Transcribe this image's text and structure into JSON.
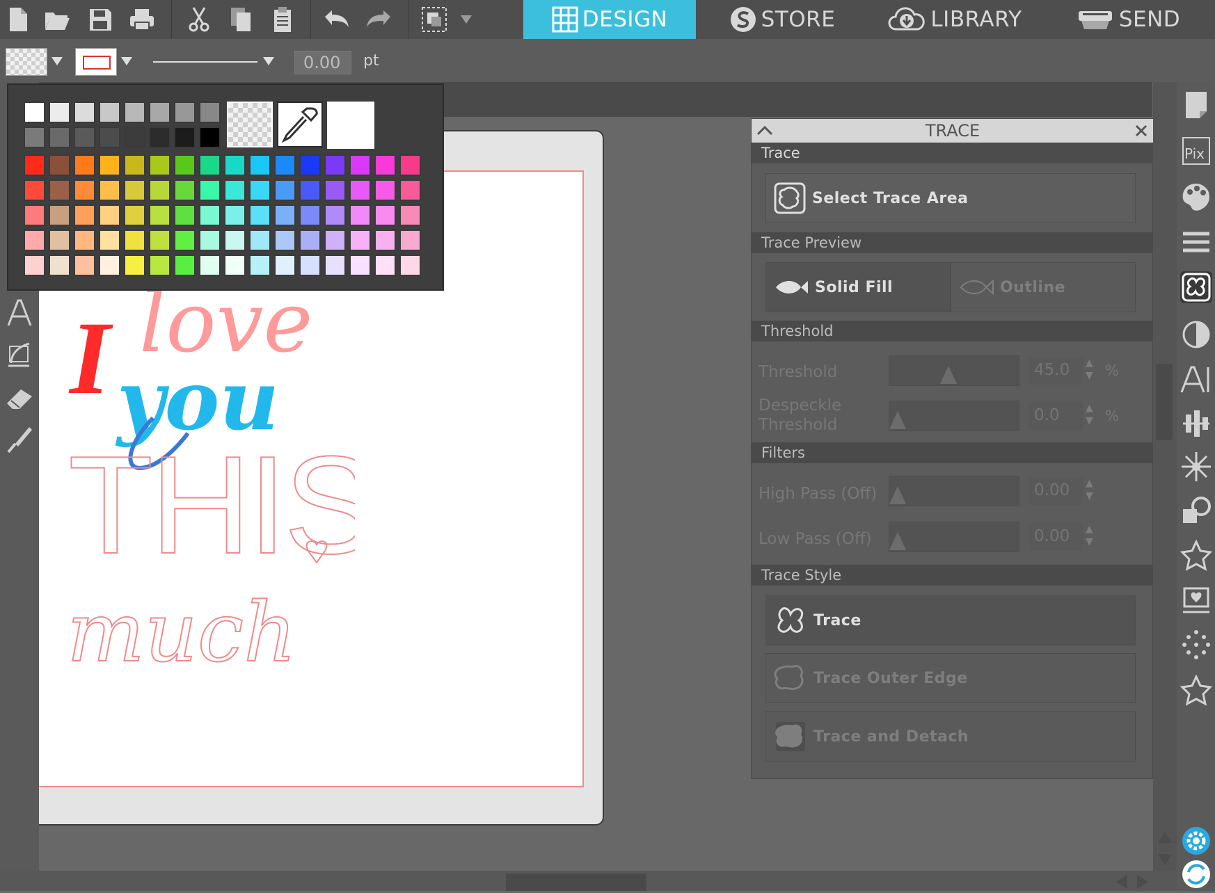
{
  "topbar": {
    "file_icons": [
      "new-document-icon",
      "open-folder-icon",
      "save-icon",
      "print-icon"
    ],
    "edit_icons": [
      "cut-icon",
      "copy-icon",
      "paste-icon"
    ],
    "history_icons": [
      "undo-icon",
      "redo-icon"
    ],
    "group_icon": "group-arrange-icon",
    "tabs": [
      {
        "label": "DESIGN",
        "icon": "grid-icon",
        "active": true
      },
      {
        "label": "STORE",
        "icon": "store-s-icon",
        "active": false
      },
      {
        "label": "LIBRARY",
        "icon": "cloud-download-icon",
        "active": false
      },
      {
        "label": "SEND",
        "icon": "cutter-icon",
        "active": false
      }
    ],
    "accent_color": "#3bbfdc"
  },
  "toolbar": {
    "line_width_value": "0.00",
    "line_width_unit": "pt"
  },
  "palette": {
    "grays_top": [
      "#ffffff",
      "#ececec",
      "#dcdcdc",
      "#c8c8c8",
      "#b8b8b8",
      "#a8a8a8",
      "#989898",
      "#888888"
    ],
    "grays_bottom": [
      "#7a7a7a",
      "#6a6a6a",
      "#5a5a5a",
      "#4c4c4c",
      "#3c3c3c",
      "#2c2c2c",
      "#1c1c1c",
      "#000000"
    ],
    "color_rows": [
      [
        "#ff2a1a",
        "#8a5038",
        "#ff7a1a",
        "#ffb21a",
        "#c8b81a",
        "#a8c81a",
        "#58c81a",
        "#1ad88a",
        "#1ad8c8",
        "#1ac8f8",
        "#1a8af8",
        "#1a3af8",
        "#7a3af8",
        "#d83af8",
        "#f83ad8",
        "#f83a8a"
      ],
      [
        "#ff4a3a",
        "#9a6048",
        "#ff8a3a",
        "#ffbe4a",
        "#d8c83a",
        "#b8d83a",
        "#68d83a",
        "#3af8aa",
        "#3ae8d8",
        "#3ad8f8",
        "#4a9af8",
        "#4a5af8",
        "#9a5af8",
        "#e85af8",
        "#f85ae8",
        "#f85a9a"
      ],
      [
        "#ff7a7a",
        "#c8a080",
        "#ffa05a",
        "#ffd080",
        "#e0d040",
        "#b8e040",
        "#60e040",
        "#7af8d0",
        "#7af0e8",
        "#5ae0f8",
        "#7ab0f8",
        "#7a8af8",
        "#b08af8",
        "#f08af8",
        "#f88af0",
        "#f88ab8"
      ],
      [
        "#ffaaaa",
        "#e0c0a0",
        "#ffb880",
        "#ffe0a0",
        "#f0e040",
        "#c0e040",
        "#60f040",
        "#aaf8e0",
        "#c8f8f0",
        "#a0e8f8",
        "#aac8f8",
        "#aab0f8",
        "#d0b0f8",
        "#f8b0f8",
        "#f8b0f0",
        "#f8aad0"
      ],
      [
        "#ffd0d0",
        "#f0e0d0",
        "#ffc0a0",
        "#fff0e0",
        "#f8f040",
        "#b8e840",
        "#58f040",
        "#e0fff0",
        "#f0fff8",
        "#b8f0f8",
        "#e0f0ff",
        "#d8e0ff",
        "#e8e0ff",
        "#f8e0ff",
        "#ffe0f8",
        "#ffd8e8"
      ]
    ],
    "special": [
      "transparent-swatch",
      "eyedropper-icon",
      "current-color-swatch"
    ]
  },
  "trace": {
    "title": "TRACE",
    "section_trace": "Trace",
    "select_trace_area": "Select Trace Area",
    "section_preview": "Trace Preview",
    "solid_fill": "Solid Fill",
    "outline": "Outline",
    "section_threshold": "Threshold",
    "threshold_label": "Threshold",
    "threshold_value": "45.0",
    "threshold_level": 0.45,
    "despeckle_label_1": "Despeckle",
    "despeckle_label_2": "Threshold",
    "despeckle_value": "0.0",
    "despeckle_level": 0,
    "percent": "%",
    "section_filters": "Filters",
    "high_pass_label": "High Pass (Off)",
    "high_pass_value": "0.00",
    "high_pass_level": 0,
    "low_pass_label": "Low Pass (Off)",
    "low_pass_value": "0.00",
    "low_pass_level": 0,
    "section_style": "Trace Style",
    "trace_btn": "Trace",
    "trace_outer_edge": "Trace Outer Edge",
    "trace_and_detach": "Trace and Detach"
  },
  "artwork": {
    "line_1": "I",
    "line_2": "love",
    "line_3": "you",
    "line_4": "THIS",
    "line_5": "much",
    "colors": {
      "i": "#ff2a2a",
      "love": "#ff9a9a",
      "you": "#22b8ec",
      "outline": "#f08a8a"
    }
  },
  "left_tools": [
    "text-tool-icon",
    "edit-points-icon",
    "eraser-icon",
    "knife-icon"
  ],
  "right_tools": [
    "page-setup-icon",
    "pixscan-icon",
    "fill-color-icon",
    "line-style-icon",
    "trace-icon",
    "image-effects-icon",
    "text-style-icon",
    "align-icon",
    "replicate-icon",
    "transform-icon",
    "offset-icon",
    "library-star-icon",
    "sketch-icon",
    "rhinestone-icon",
    "favorites-star-icon",
    "settings-gear-icon",
    "sync-icon"
  ]
}
